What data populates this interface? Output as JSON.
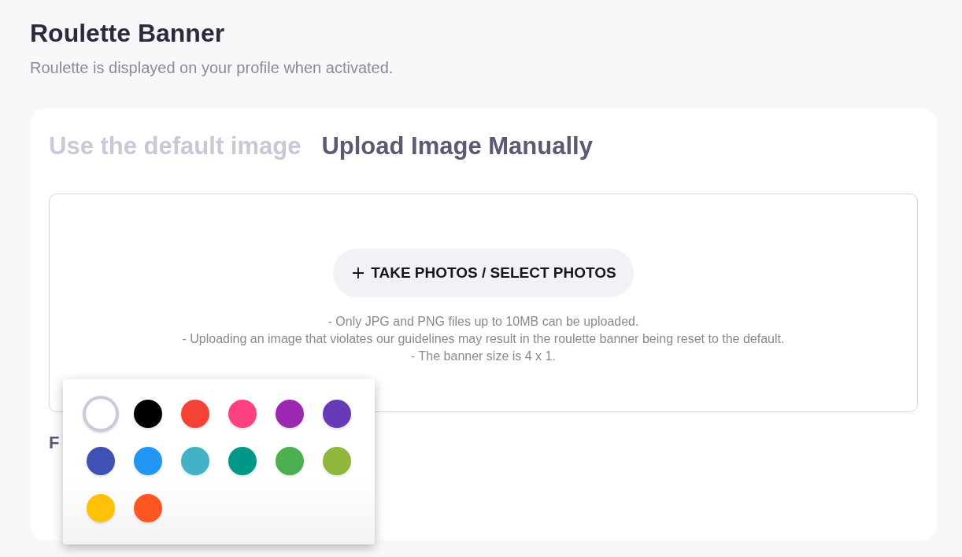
{
  "header": {
    "title": "Roulette Banner",
    "subtitle": "Roulette is displayed on your profile when activated."
  },
  "tabs": [
    {
      "label": "Use the default image",
      "selected": false
    },
    {
      "label": "Upload Image Manually",
      "selected": true
    }
  ],
  "upload": {
    "button": "TAKE PHOTOS / SELECT PHOTOS",
    "notes": [
      "- Only JPG and PNG files up to 10MB can be uploaded.",
      "- Uploading an image that violates our guidelines may result in the roulette banner being reset to the default.",
      "- The banner size is 4 x 1."
    ]
  },
  "section_label": "F",
  "color_picker": {
    "swatches": [
      {
        "color": "#ffffff",
        "selected": true
      },
      {
        "color": "#000000",
        "selected": false
      },
      {
        "color": "#f44336",
        "selected": false
      },
      {
        "color": "#ff4081",
        "selected": false
      },
      {
        "color": "#9c27b0",
        "selected": false
      },
      {
        "color": "#673ab7",
        "selected": false
      },
      {
        "color": "#3f51b5",
        "selected": false
      },
      {
        "color": "#2196f3",
        "selected": false
      },
      {
        "color": "#42b1c6",
        "selected": false
      },
      {
        "color": "#009688",
        "selected": false
      },
      {
        "color": "#4caf50",
        "selected": false
      },
      {
        "color": "#8fb73c",
        "selected": false
      },
      {
        "color": "#ffc107",
        "selected": false
      },
      {
        "color": "#ff5722",
        "selected": false
      }
    ]
  }
}
